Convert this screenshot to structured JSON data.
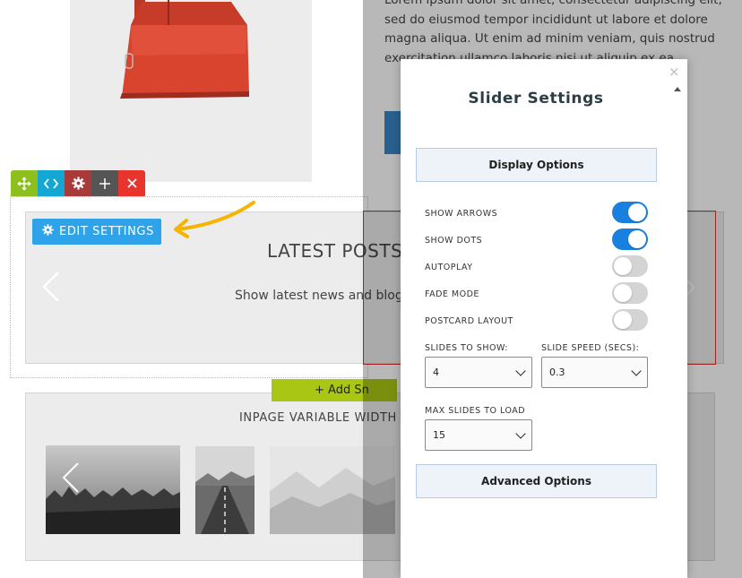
{
  "background": {
    "body_text": "Lorem ipsum dolor sit amet, consectetur adipiscing elit, sed do eiusmod tempor incididunt ut labore et dolore magna aliqua. Ut enim ad minim veniam, quis nostrud exercitation ullamco laboris nisi ut aliquip ex ea",
    "latest_posts": {
      "title": "LATEST POSTS",
      "subtitle": "Show latest news and blog"
    },
    "add_button_label": "+ Add Sn",
    "inpage_title": "INPAGE VARIABLE WIDTH C"
  },
  "toolbar": {
    "items": [
      {
        "icon": "move-icon",
        "color": "#8dbf1e"
      },
      {
        "icon": "code-icon",
        "color": "#14a7d4"
      },
      {
        "icon": "gear-icon",
        "color": "#a83a3a"
      },
      {
        "icon": "plus-icon",
        "color": "#555555"
      },
      {
        "icon": "close-icon",
        "color": "#e8342c"
      }
    ]
  },
  "edit_settings": {
    "label": "EDIT SETTINGS",
    "icon": "gear-icon",
    "color": "#2fa3ea"
  },
  "annotation": {
    "icon": "curved-arrow-icon",
    "color": "#f5b400"
  },
  "modal": {
    "title": "Slider Settings",
    "close_glyph": "×",
    "sections": {
      "display": "Display Options",
      "advanced": "Advanced Options"
    },
    "options": [
      {
        "label": "SHOW ARROWS",
        "on": true
      },
      {
        "label": "SHOW DOTS",
        "on": true
      },
      {
        "label": "AUTOPLAY",
        "on": false
      },
      {
        "label": "FADE MODE",
        "on": false
      },
      {
        "label": "POSTCARD LAYOUT",
        "on": false
      }
    ],
    "fields": {
      "slides_to_show": {
        "label": "SLIDES TO SHOW:",
        "value": "4"
      },
      "slide_speed": {
        "label": "SLIDE SPEED (SECS):",
        "value": "0.3"
      },
      "max_slides": {
        "label": "MAX SLIDES TO LOAD",
        "value": "15"
      }
    },
    "accent_color": "#1a80e0"
  }
}
